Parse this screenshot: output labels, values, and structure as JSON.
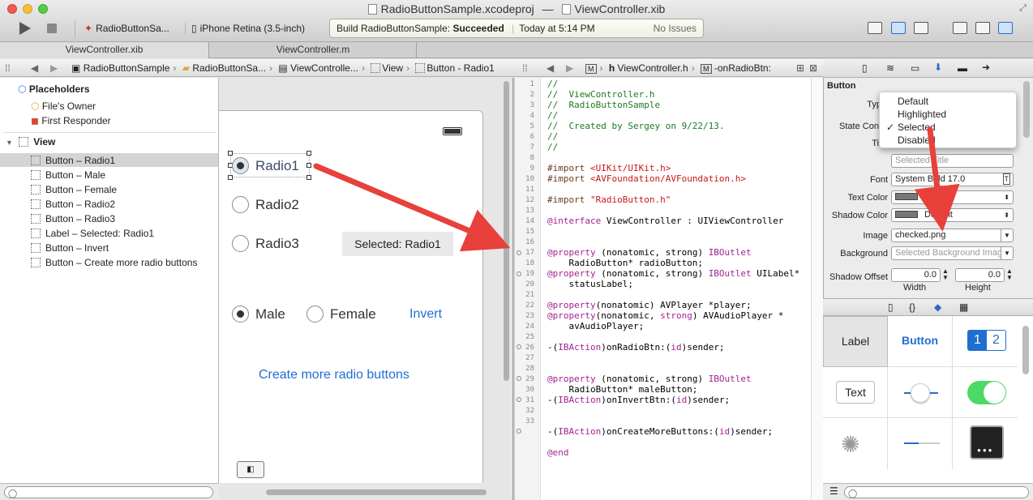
{
  "window": {
    "title": "RadioButtonSample.xcodeproj",
    "title_sep": "—",
    "file_title": "ViewController.xib"
  },
  "toolbar": {
    "scheme": "RadioButtonSa...",
    "device": "iPhone Retina (3.5-inch)",
    "status_prefix": "Build RadioButtonSample:",
    "status_result": "Succeeded",
    "status_time": "Today at 5:14 PM",
    "status_issues": "No Issues"
  },
  "tabs": [
    "ViewController.xib",
    "ViewController.m"
  ],
  "jumpbar_left": [
    "RadioButtonSample",
    "RadioButtonSa...",
    "ViewControlle...",
    "View",
    "Button - Radio1"
  ],
  "jumpbar_right": [
    "ViewController.h",
    "-onRadioBtn:"
  ],
  "outline": {
    "placeholders_title": "Placeholders",
    "placeholders": [
      "File's Owner",
      "First Responder"
    ],
    "view_title": "View",
    "items": [
      "Button – Radio1",
      "Button – Male",
      "Button – Female",
      "Button – Radio2",
      "Button – Radio3",
      "Label – Selected: Radio1",
      "Button – Invert",
      "Button – Create more radio buttons"
    ]
  },
  "canvas": {
    "radio1": "Radio1",
    "radio2": "Radio2",
    "radio3": "Radio3",
    "selected_label": "Selected: Radio1",
    "male": "Male",
    "female": "Female",
    "invert": "Invert",
    "create_more": "Create more radio buttons"
  },
  "code": {
    "line_numbers": [
      "1",
      "2",
      "3",
      "4",
      "5",
      "6",
      "7",
      "8",
      "9",
      "10",
      "11",
      "12",
      "13",
      "14",
      "15",
      "16",
      "17",
      "18",
      "19",
      "20",
      "21",
      "22",
      "23",
      "24",
      "25",
      "26",
      "27",
      "28",
      "29",
      "30",
      "31",
      "32",
      "33"
    ],
    "l1": "//",
    "l2": "//  ViewController.h",
    "l3": "//  RadioButtonSample",
    "l4": "//",
    "l5": "//  Created by Sergey on 9/22/13.",
    "l6": "//",
    "l7": "//",
    "l9a": "#import ",
    "l9b": "<UIKit/UIKit.h>",
    "l10a": "#import ",
    "l10b": "<AVFoundation/AVFoundation.h>",
    "l12a": "#import ",
    "l12b": "\"RadioButton.h\"",
    "l14a": "@interface",
    "l14b": " ViewController : UIViewController",
    "l17a": "@property",
    "l17b": " (nonatomic, strong) ",
    "l17c": "IBOutlet",
    "l17d": "    RadioButton* radioButton;",
    "l18a": "@property",
    "l18b": " (nonatomic, strong) ",
    "l18c": "IBOutlet",
    "l18e": " UILabel*",
    "l18d": "    statusLabel;",
    "l20a": "@property",
    "l20b": "(nonatomic) AVPlayer *player;",
    "l21a": "@property",
    "l21b": "(nonatomic, ",
    "l21c": "strong",
    "l21e": ") AVAudioPlayer *",
    "l21d": "    avAudioPlayer;",
    "l23a": "-(",
    "l23b": "IBAction",
    "l23c": ")onRadioBtn:(",
    "l23d": "id",
    "l23e": ")sender;",
    "l26a": "@property",
    "l26b": " (nonatomic, strong) ",
    "l26c": "IBOutlet",
    "l26d": "    RadioButton* maleButton;",
    "l27a": "-(",
    "l27b": "IBAction",
    "l27c": ")onInvertBtn:(",
    "l27d": "id",
    "l27e": ")sender;",
    "l30a": "-(",
    "l30b": "IBAction",
    "l30c": ")onCreateMoreButtons:(",
    "l30d": "id",
    "l30e": ")sender;",
    "l32": "@end"
  },
  "inspector": {
    "section": "Button",
    "type_label": "Typ",
    "state_label": "State Conf",
    "title_label": "Tit",
    "title_placeholder": "Selected Title",
    "font_label": "Font",
    "font_value": "System Bold 17.0",
    "text_color_label": "Text Color",
    "text_color_value": "Default",
    "shadow_color_label": "Shadow Color",
    "shadow_color_value": "Default",
    "image_label": "Image",
    "image_value": "checked.png",
    "background_label": "Background",
    "background_placeholder": "Selected Background Image",
    "shadow_offset_label": "Shadow Offset",
    "shadow_w": "0.0",
    "shadow_h": "0.0",
    "width_label": "Width",
    "height_label": "Height",
    "popup": {
      "options": [
        "Default",
        "Highlighted",
        "Selected",
        "Disabled"
      ],
      "checked": "✓"
    }
  },
  "library": {
    "label": "Label",
    "button": "Button",
    "seg1": "1",
    "seg2": "2",
    "text": "Text"
  },
  "colors": {
    "accent": "#1f6fd1",
    "arrow": "#e8403a"
  }
}
